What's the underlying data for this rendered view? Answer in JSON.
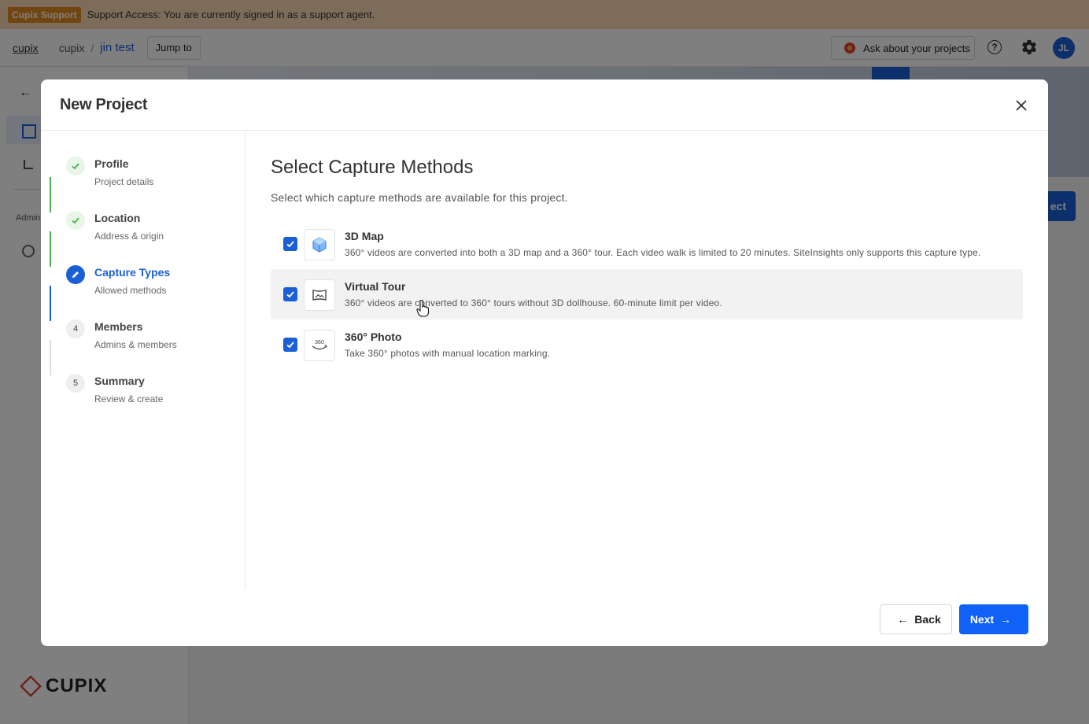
{
  "support_banner": {
    "badge": "Cupix Support",
    "message": "Support Access: You are currently signed in as a support agent."
  },
  "topbar": {
    "breadcrumb_root": "cupix",
    "breadcrumb_org": "cupix",
    "breadcrumb_separator": "/",
    "breadcrumb_current": "jin test",
    "jump_to_label": "Jump to",
    "ask_label": "Ask about your projects",
    "help_icon": "?",
    "avatar_initials": "JL"
  },
  "background": {
    "admin_label": "Admin",
    "create_button_partial": "ect",
    "logo_text": "CUPIX"
  },
  "modal": {
    "title": "New Project",
    "steps": [
      {
        "label": "Profile",
        "sub": "Project details",
        "status": "done"
      },
      {
        "label": "Location",
        "sub": "Address & origin",
        "status": "done"
      },
      {
        "label": "Capture Types",
        "sub": "Allowed methods",
        "status": "current"
      },
      {
        "label": "Members",
        "sub": "Admins & members",
        "status": "pending",
        "number": "4"
      },
      {
        "label": "Summary",
        "sub": "Review & create",
        "status": "pending",
        "number": "5"
      }
    ],
    "content_title": "Select Capture Methods",
    "content_desc": "Select which capture methods are available for this project.",
    "options": [
      {
        "title": "3D Map",
        "desc": "360° videos are converted into both a 3D map and a 360° tour. Each video walk is limited to 20 minutes. SiteInsights only supports this capture type.",
        "checked": true,
        "icon": "cube-icon"
      },
      {
        "title": "Virtual Tour",
        "desc": "360° videos are converted to 360° tours without 3D dollhouse. 60-minute limit per video.",
        "checked": true,
        "icon": "panorama-icon"
      },
      {
        "title": "360° Photo",
        "desc": "Take 360° photos with manual location marking.",
        "checked": true,
        "icon": "photo-360-icon",
        "icon_text": "360"
      }
    ],
    "back_label": "Back",
    "next_label": "Next"
  },
  "colors": {
    "primary": "#1a5fd6",
    "next_button": "#0f62f5",
    "step_done": "#4caf50",
    "banner": "#f9d8b3",
    "badge": "#e08a1f"
  }
}
